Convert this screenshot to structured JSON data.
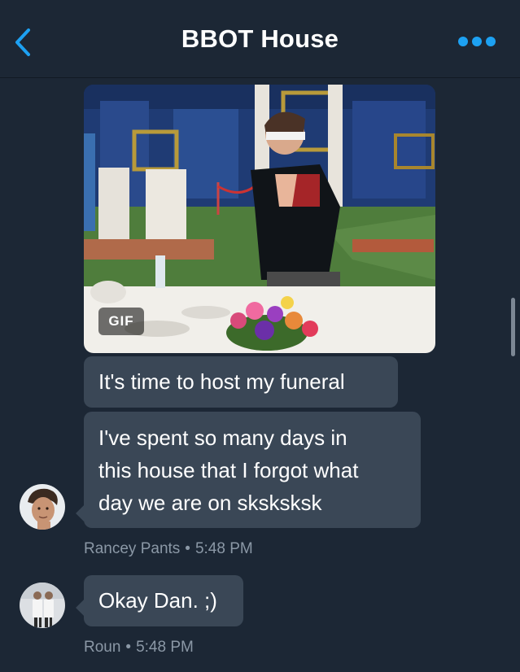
{
  "header": {
    "title": "BBOT House"
  },
  "gif": {
    "badge": "GIF"
  },
  "messages": [
    {
      "text": "It's time to host my funeral"
    },
    {
      "text": "I've spent so many days in\nthis house that I forgot what\nday we are on sksksksk"
    },
    {
      "text": "Okay Dan. ;)"
    }
  ],
  "meta": [
    {
      "sender": "Rancey Pants",
      "separator": "•",
      "time": "5:48 PM"
    },
    {
      "sender": "Roun",
      "separator": "•",
      "time": "5:48 PM"
    }
  ],
  "colors": {
    "background": "#1c2735",
    "bubble": "#3a4756",
    "accent": "#1da1f2",
    "meta_text": "#8b98a6"
  },
  "icons": {
    "back": "chevron-left-icon",
    "more": "more-dots-icon"
  }
}
